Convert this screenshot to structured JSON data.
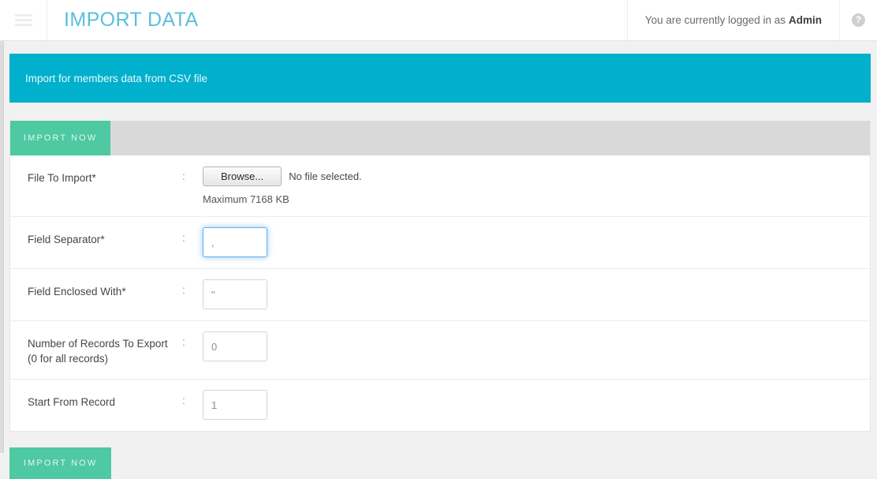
{
  "topbar": {
    "menu_icon": "hamburger-icon",
    "title": "IMPORT DATA",
    "login_prefix": "You are currently logged in as",
    "login_user": "Admin",
    "help_icon": "question-mark-icon",
    "help_glyph": "?",
    "title_color": "#5bbfdd"
  },
  "notice": {
    "text": "Import for members data from CSV file",
    "background": "#00b0cc"
  },
  "panel": {
    "tab_label": "IMPORT NOW",
    "tab_color": "#4ec9a1",
    "colon": ":",
    "rows": [
      {
        "label": "File To Import",
        "required": "*",
        "browse_label": "Browse...",
        "file_status": "No file selected.",
        "hint": "Maximum 7168 KB"
      },
      {
        "label": "Field Separator",
        "required": "*",
        "value": ",",
        "focused": true
      },
      {
        "label": "Field Enclosed With",
        "required": "*",
        "value": "\""
      },
      {
        "label": "Number of Records To Export (0 for all records)",
        "required": "",
        "value": "0"
      },
      {
        "label": "Start From Record",
        "required": "",
        "value": "1"
      }
    ]
  },
  "footer": {
    "submit_label": "IMPORT NOW"
  }
}
